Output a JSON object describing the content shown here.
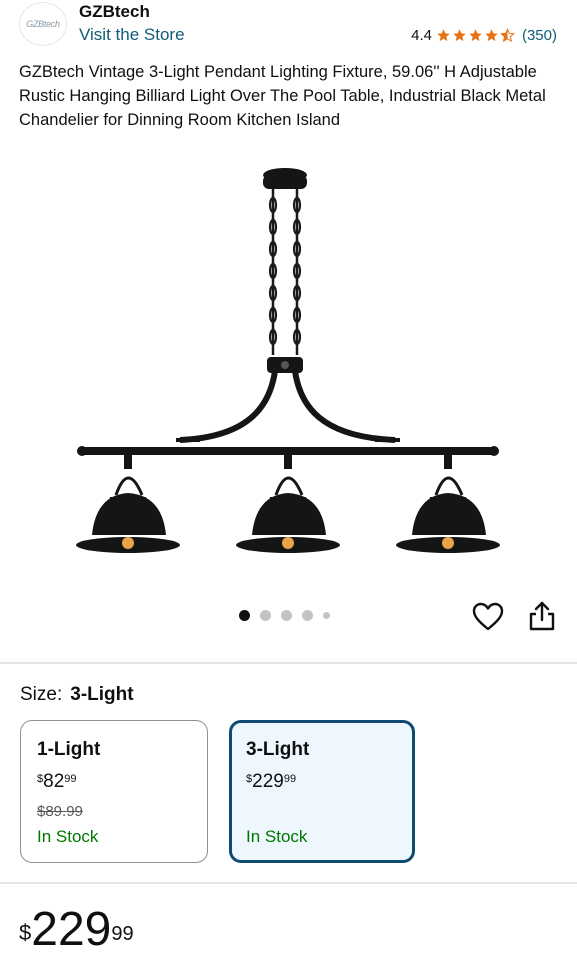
{
  "seller": {
    "logo_text": "GZBtech",
    "brand": "GZBtech",
    "store_link": "Visit the Store",
    "rating_value": "4.4",
    "rating_count": "(350)",
    "stars": 4.4
  },
  "product": {
    "title": "GZBtech Vintage 3-Light Pendant Lighting Fixture, 59.06'' H Adjustable Rustic Hanging Billiard Light Over The Pool Table, Industrial Black Metal Chandelier for Dinning Room Kitchen Island",
    "image_count": 5,
    "active_image": 1
  },
  "icons": {
    "wishlist": "heart-icon",
    "share": "share-icon"
  },
  "size": {
    "label": "Size:",
    "selected": "3-Light",
    "options": [
      {
        "name": "1-Light",
        "currency": "$",
        "whole": "82",
        "fraction": "99",
        "old_price": "$89.99",
        "stock": "In Stock"
      },
      {
        "name": "3-Light",
        "currency": "$",
        "whole": "229",
        "fraction": "99",
        "stock": "In Stock"
      }
    ]
  },
  "price": {
    "currency": "$",
    "whole": "229",
    "fraction": "99"
  },
  "colors": {
    "link": "#0f5c7a",
    "stock": "#007600",
    "star": "#e57316",
    "selected_border": "#0f4a73"
  }
}
